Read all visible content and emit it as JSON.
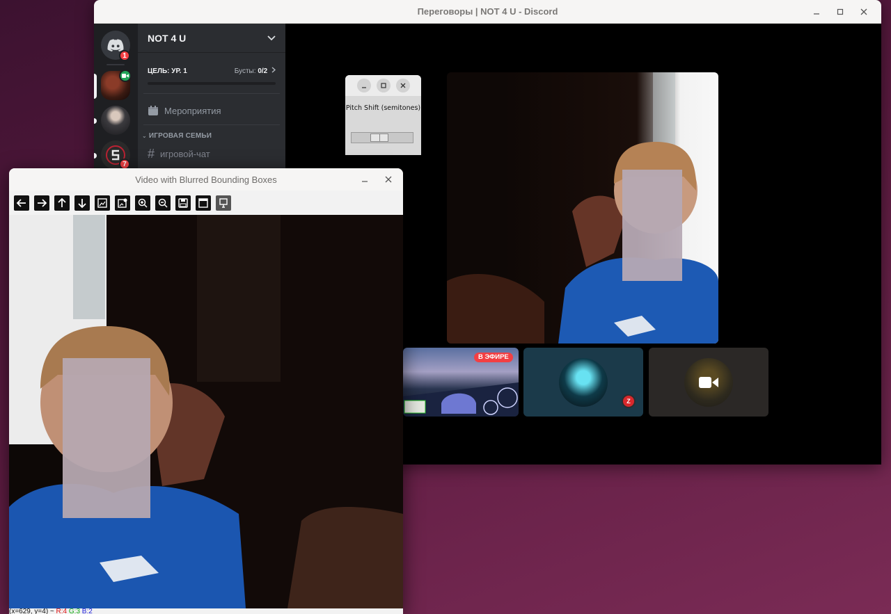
{
  "discord": {
    "window_title": "Переговоры | NOT 4 U - Discord",
    "server_name": "NOT 4 U",
    "boost_goal": "ЦЕЛЬ: УР. 1",
    "boost_label": "Бусты:",
    "boost_count": "0/2",
    "boost_progress": 0,
    "events_label": "Мероприятия",
    "category_name": "ИГРОВАЯ СЕМЬИ",
    "channel_name": "игровой-чат",
    "rail_badges": {
      "home": "1",
      "server4": "7"
    },
    "live_badge": "В ЭФИРЕ",
    "tile_badge": "Z"
  },
  "pitch_window": {
    "label": "Pitch Shift (semitones)",
    "slider_value": 0.45
  },
  "blur_window": {
    "title": "Video with Blurred Bounding Boxes",
    "status_coords": "(x=629, y=4) ~",
    "status_r": "R:4",
    "status_g": "G:3",
    "status_b": "B:2"
  },
  "colors": {
    "discord_bg": "#1e1f22",
    "channel_bg": "#2b2d31",
    "live_red": "#f23f43",
    "boost_green": "#23a559"
  },
  "icons": {
    "toolbar": [
      "arrow-left-icon",
      "arrow-right-icon",
      "arrow-up-icon",
      "arrow-down-icon",
      "image-icon",
      "image-settings-icon",
      "zoom-in-icon",
      "zoom-out-icon",
      "save-icon",
      "window-icon",
      "properties-icon"
    ]
  }
}
